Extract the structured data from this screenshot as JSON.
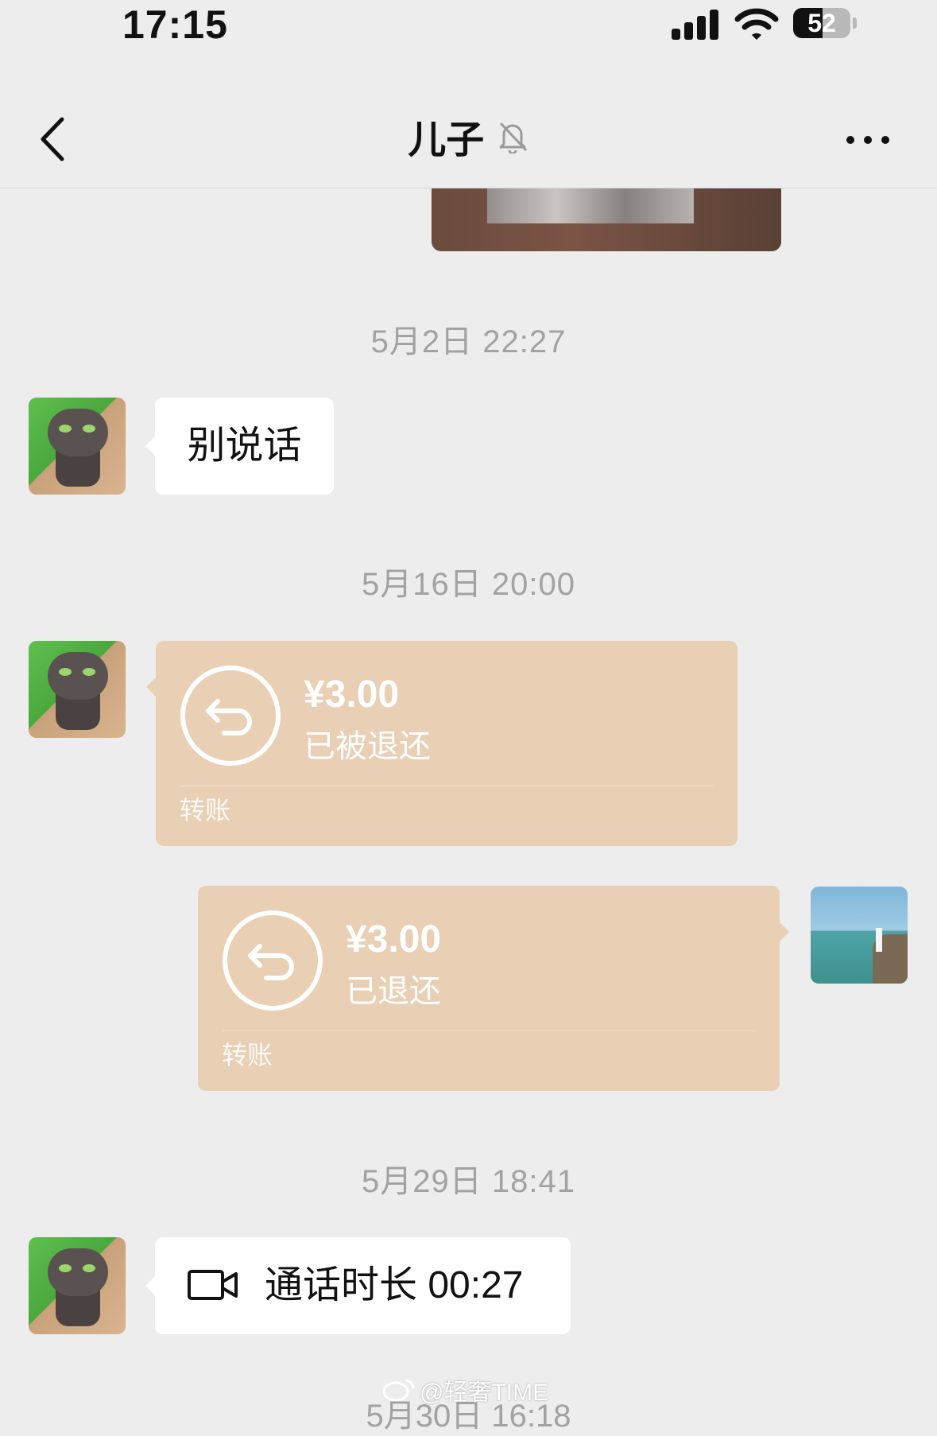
{
  "status_bar": {
    "time": "17:15",
    "battery_level": "52",
    "icons": [
      "signal-icon",
      "wifi-icon",
      "battery-icon"
    ]
  },
  "nav": {
    "title": "儿子",
    "back_icon": "chevron-left-icon",
    "mute_icon": "bell-slash-icon",
    "more_icon": "more-dots-icon"
  },
  "messages": {
    "ts1": "5月2日 22:27",
    "text1": "别说话",
    "ts2": "5月16日 20:00",
    "transfer1": {
      "amount": "¥3.00",
      "status": "已被退还",
      "label": "转账",
      "icon": "return-arrow-icon"
    },
    "transfer2": {
      "amount": "¥3.00",
      "status": "已退还",
      "label": "转账",
      "icon": "return-arrow-icon"
    },
    "ts3": "5月29日 18:41",
    "call": {
      "text": "通话时长 00:27",
      "icon": "video-camera-icon"
    },
    "ts4_partial": "5月30日 16:18"
  },
  "watermark": "@轻奢TIME",
  "colors": {
    "background": "#ededed",
    "transfer_bubble": "#e9cfb4",
    "timestamp_text": "#a2a2a2"
  }
}
